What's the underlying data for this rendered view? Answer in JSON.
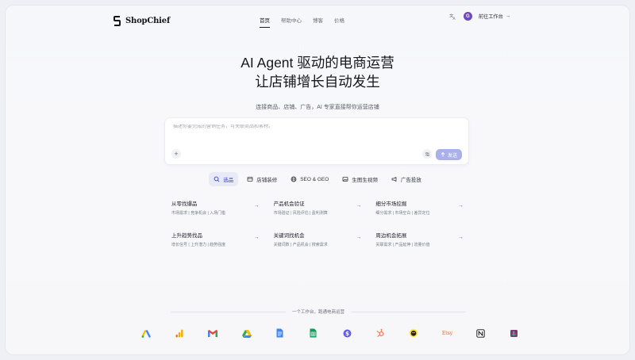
{
  "brand": {
    "name": "ShopChief"
  },
  "nav": [
    {
      "label": "首页",
      "active": true
    },
    {
      "label": "帮助中心",
      "active": false
    },
    {
      "label": "博客",
      "active": false
    },
    {
      "label": "价格",
      "active": false
    }
  ],
  "header": {
    "avatar_initial": "G",
    "workspace_label": "前往工作台",
    "workspace_arrow": "→"
  },
  "hero": {
    "title_line1": "AI Agent 驱动的电商运营",
    "title_line2": "让店铺增长自动发生",
    "subtitle": "连接商品、店铺、广告，AI 专家直接帮你运营店铺"
  },
  "prompt": {
    "placeholder": "描述你要完成的营销任务，可关联商品和素材。",
    "add_label": "+",
    "send_label": "发送"
  },
  "tabs": [
    {
      "label": "选品",
      "icon": "search-icon",
      "active": true
    },
    {
      "label": "店铺装修",
      "icon": "store-icon",
      "active": false
    },
    {
      "label": "SEO & GEO",
      "icon": "globe-icon",
      "active": false
    },
    {
      "label": "生图生视频",
      "icon": "image-icon",
      "active": false
    },
    {
      "label": "广告投放",
      "icon": "megaphone-icon",
      "active": false
    }
  ],
  "cards": [
    {
      "title": "从零找爆品",
      "tags": "市场需求 | 竞争机会 | 入场门槛"
    },
    {
      "title": "产品机会验证",
      "tags": "市场验证 | 风险评估 | 盈利测算"
    },
    {
      "title": "细分市场挖掘",
      "tags": "细分需求 | 市场空白 | 差异定位"
    },
    {
      "title": "上升趋势找品",
      "tags": "增长信号 | 上升潜力 | 趋势强度"
    },
    {
      "title": "关键词找机会",
      "tags": "关键词数 | 产品机会 | 搜索需求"
    },
    {
      "title": "周边机会拓展",
      "tags": "关联需求 | 产品延伸 | 流量价值"
    }
  ],
  "footer": {
    "divider_text": "一个工作台，跑通电商运营",
    "integrations": [
      "google-ads-icon",
      "analytics-icon",
      "gmail-icon",
      "google-drive-icon",
      "google-docs-icon",
      "google-sheets-icon",
      "stripe-icon",
      "hubspot-icon",
      "mailchimp-icon",
      "etsy-icon",
      "notion-icon",
      "slack-icon"
    ],
    "etsy_text": "Etsy"
  },
  "colors": {
    "accent": "#3f47b8",
    "send_button": "#aab0ea",
    "avatar": "#6d4ab8"
  }
}
